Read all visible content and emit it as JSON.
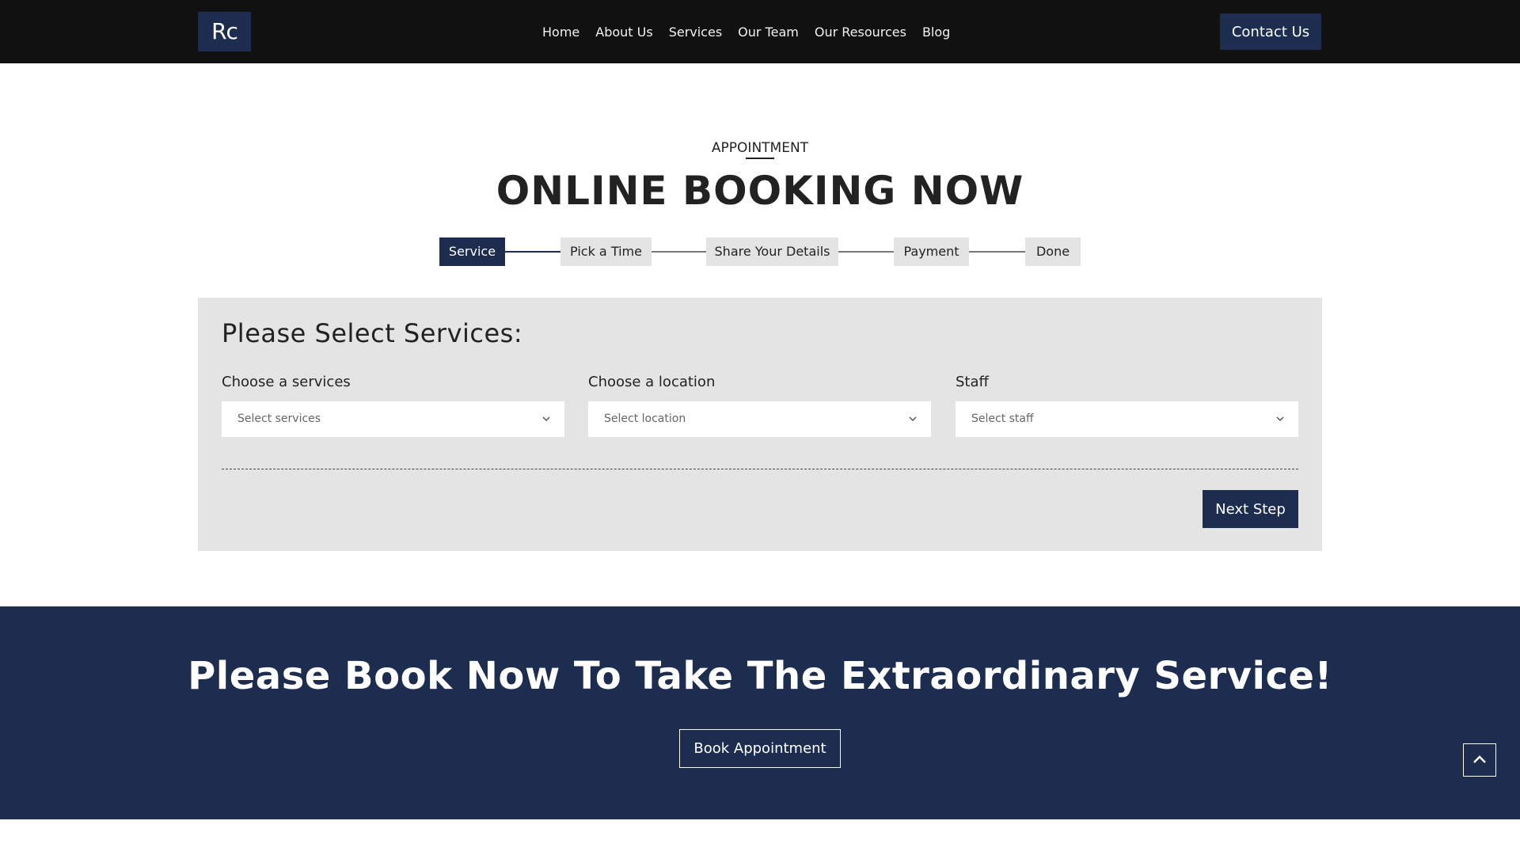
{
  "header": {
    "logo_text": "Rc",
    "nav": [
      "Home",
      "About Us",
      "Services",
      "Our Team",
      "Our Resources",
      "Blog"
    ],
    "contact_label": "Contact Us"
  },
  "section": {
    "eyebrow": "APPOINTMENT",
    "title": "ONLINE BOOKING NOW"
  },
  "steps": [
    "Service",
    "Pick a Time",
    "Share Your Details",
    "Payment",
    "Done"
  ],
  "active_step": "Service",
  "form": {
    "title": "Please Select Services:",
    "fields": [
      {
        "label": "Choose a services",
        "placeholder": "Select services"
      },
      {
        "label": "Choose a location",
        "placeholder": "Select location"
      },
      {
        "label": "Staff",
        "placeholder": "Select staff"
      }
    ],
    "next_label": "Next Step"
  },
  "cta": {
    "title": "Please Book Now To Take The Extraordinary Service!",
    "button_label": "Book Appointment"
  },
  "colors": {
    "header_bg": "#111111",
    "accent": "#1d2d50",
    "panel_bg": "#e4e4e4"
  },
  "icons": {
    "chevron": "chevron-down-icon",
    "scroll_top": "chevron-up-icon"
  }
}
